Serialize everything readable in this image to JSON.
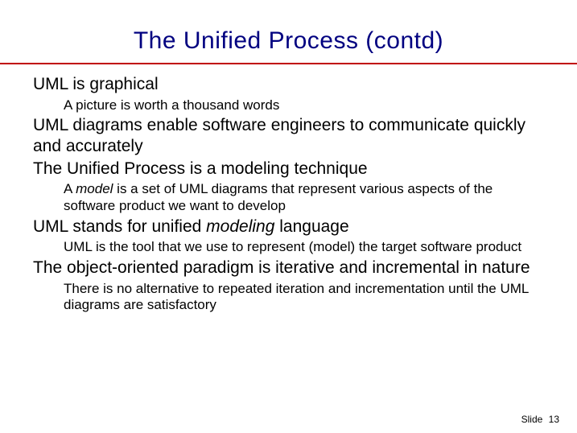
{
  "title": "The Unified Process (contd)",
  "points": {
    "p1": "UML is graphical",
    "p1a": "A picture is worth a thousand words",
    "p2": "UML diagrams enable software engineers to communicate quickly and accurately",
    "p3": "The Unified Process is a modeling technique",
    "p3a_pre": "A ",
    "p3a_em": "model",
    "p3a_post": " is a set of UML diagrams that represent various aspects of the software product we want to develop",
    "p4_pre": "UML stands for unified ",
    "p4_em": "modeling",
    "p4_post": " language",
    "p4a": "UML is the tool that we use to represent (model) the target software product",
    "p5": "The object-oriented paradigm is iterative and incremental in nature",
    "p5a": "There is no alternative to repeated iteration and incrementation until the UML diagrams are satisfactory"
  },
  "footer": {
    "label": "Slide",
    "num": "13"
  }
}
